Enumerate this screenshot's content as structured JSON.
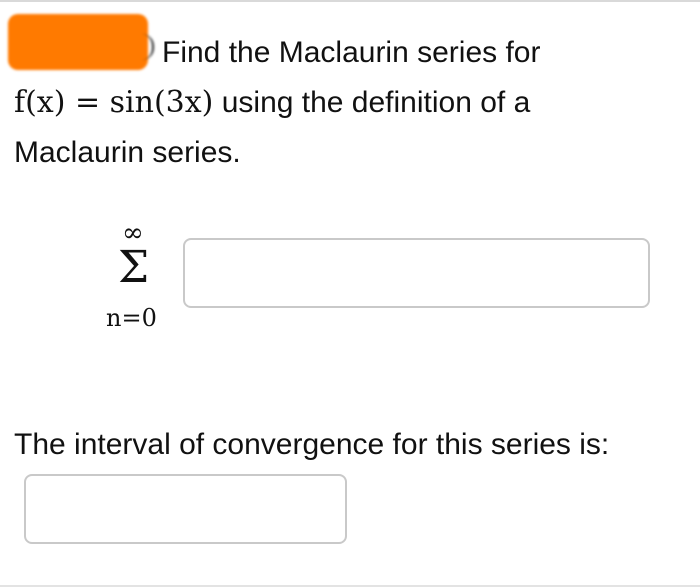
{
  "question": {
    "line1": "Find the Maclaurin series for",
    "func_lhs": "f(x) = sin(3x)",
    "line2_suffix": "using the definition of a",
    "line3": "Maclaurin series."
  },
  "summation": {
    "upper": "∞",
    "symbol": "Σ",
    "lower": "n=0"
  },
  "series_input": {
    "value": ""
  },
  "interval": {
    "label": "The interval of convergence for this series is:",
    "value": ""
  },
  "colors": {
    "redaction": "#ff7a00",
    "input_border": "#c9c9c9"
  }
}
